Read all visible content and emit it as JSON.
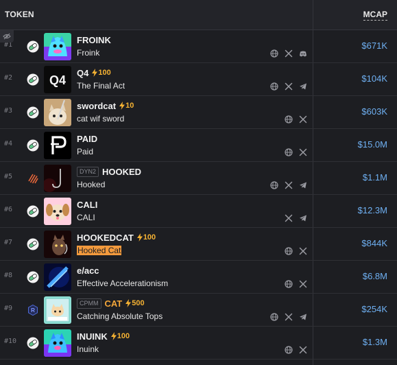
{
  "header": {
    "token_label": "TOKEN",
    "mcap_label": "MCAP"
  },
  "colors": {
    "mcap": "#6fb0f2",
    "boost": "#f5b233",
    "highlight": "#f39a3d",
    "background": "#1d1e22"
  },
  "icons": {
    "hide": "eye-slash-icon",
    "platform_pump": "pill-icon",
    "platform_hooked": "stripes-icon",
    "platform_cpmm": "hexagon-icon",
    "web": "globe-icon",
    "x": "x-icon",
    "discord": "discord-icon",
    "telegram": "telegram-icon"
  },
  "rows": [
    {
      "rank": "#1",
      "ticker": "FROINK",
      "name": "Froink",
      "mcap": "$671K",
      "platform": "pump",
      "socials": [
        "web",
        "x",
        "discord"
      ]
    },
    {
      "rank": "#2",
      "ticker": "Q4",
      "boost": "100",
      "name": "The Final Act",
      "mcap": "$104K",
      "platform": "pump",
      "socials": [
        "web",
        "x",
        "telegram"
      ]
    },
    {
      "rank": "#3",
      "ticker": "swordcat",
      "boost": "10",
      "name": "cat wif sword",
      "mcap": "$603K",
      "platform": "pump",
      "socials": [
        "web",
        "x"
      ]
    },
    {
      "rank": "#4",
      "ticker": "PAID",
      "name": "Paid",
      "mcap": "$15.0M",
      "platform": "pump",
      "socials": [
        "web",
        "x"
      ]
    },
    {
      "rank": "#5",
      "ticker": "HOOKED",
      "tag": "DYN2",
      "name": "Hooked",
      "mcap": "$1.1M",
      "platform": "hooked",
      "socials": [
        "web",
        "x",
        "telegram"
      ]
    },
    {
      "rank": "#6",
      "ticker": "CALI",
      "name": "CALI",
      "mcap": "$12.3M",
      "platform": "pump",
      "socials": [
        "x",
        "telegram"
      ]
    },
    {
      "rank": "#7",
      "ticker": "HOOKEDCAT",
      "boost": "100",
      "name": "Hooked Cat",
      "highlight": true,
      "mcap": "$844K",
      "platform": "pump",
      "socials": [
        "web",
        "x"
      ]
    },
    {
      "rank": "#8",
      "ticker": "e/acc",
      "name": "Effective Accelerationism",
      "mcap": "$6.8M",
      "platform": "pump",
      "socials": [
        "web",
        "x"
      ]
    },
    {
      "rank": "#9",
      "ticker": "CAT",
      "tag": "CPMM",
      "boost": "500",
      "ticker_orange": true,
      "name": "Catching Absolute Tops",
      "mcap": "$254K",
      "platform": "cpmm",
      "socials": [
        "web",
        "x",
        "telegram"
      ]
    },
    {
      "rank": "#10",
      "ticker": "INUINK",
      "boost": "100",
      "name": "Inuink",
      "mcap": "$1.3M",
      "platform": "pump",
      "socials": [
        "web",
        "x"
      ]
    }
  ]
}
